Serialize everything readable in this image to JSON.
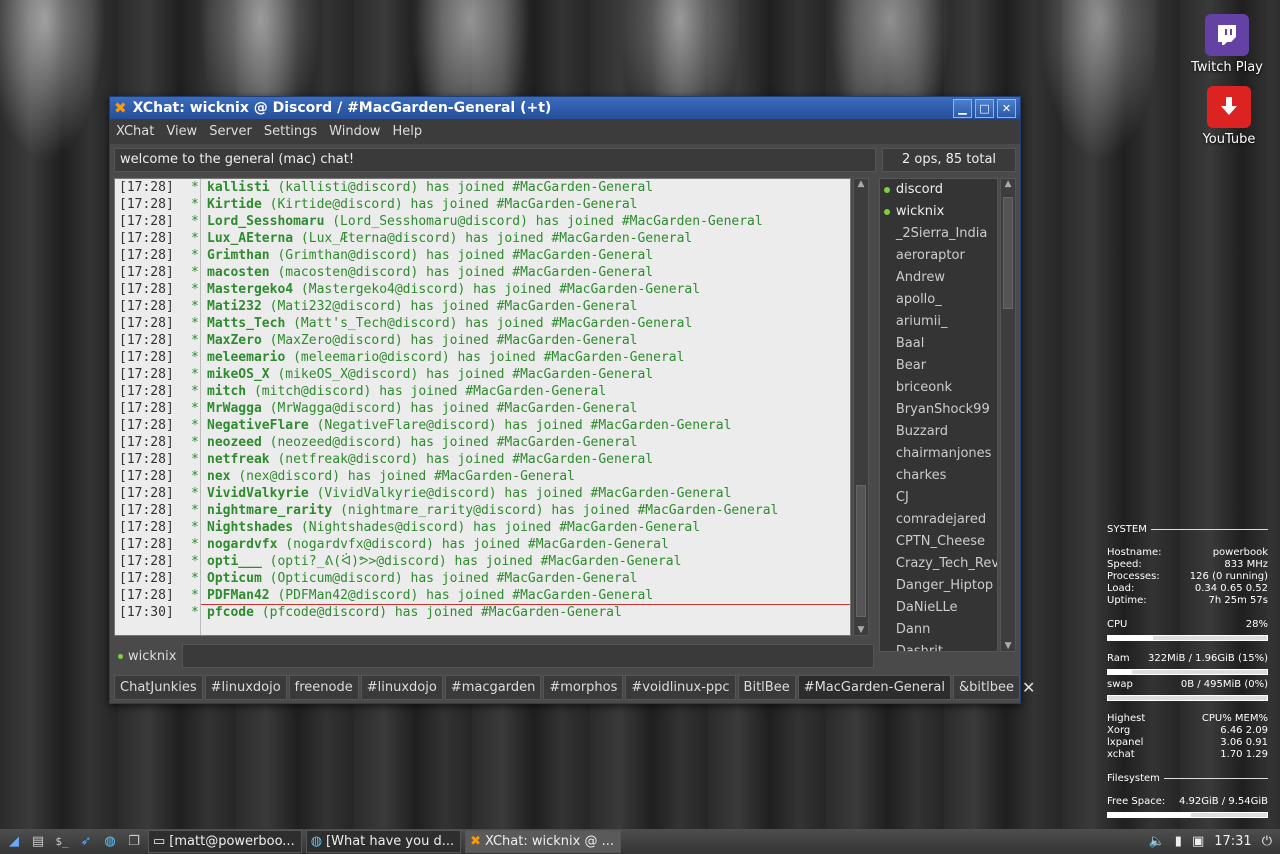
{
  "desktop": {
    "icons": [
      {
        "label": "Twitch Play"
      },
      {
        "label": "YouTube"
      }
    ]
  },
  "window": {
    "title": "XChat: wicknix @ Discord / #MacGarden-General (+t)",
    "menu": [
      "XChat",
      "View",
      "Server",
      "Settings",
      "Window",
      "Help"
    ],
    "topic": "welcome to the general (mac) chat!",
    "user_count": "2 ops, 85 total",
    "nick": "wicknix",
    "messages": [
      {
        "time": "[17:28]",
        "nick": "kallisti",
        "text": "(kallisti@discord) has joined #MacGarden-General"
      },
      {
        "time": "[17:28]",
        "nick": "Kirtide",
        "text": "(Kirtide@discord) has joined #MacGarden-General"
      },
      {
        "time": "[17:28]",
        "nick": "Lord_Sesshomaru",
        "text": "(Lord_Sesshomaru@discord) has joined #MacGarden-General"
      },
      {
        "time": "[17:28]",
        "nick": "Lux_AEterna",
        "text": "(Lux_Æterna@discord) has joined #MacGarden-General"
      },
      {
        "time": "[17:28]",
        "nick": "Grimthan",
        "text": "(Grimthan@discord) has joined #MacGarden-General"
      },
      {
        "time": "[17:28]",
        "nick": "macosten",
        "text": "(macosten@discord) has joined #MacGarden-General"
      },
      {
        "time": "[17:28]",
        "nick": "Mastergeko4",
        "text": "(Mastergeko4@discord) has joined #MacGarden-General"
      },
      {
        "time": "[17:28]",
        "nick": "Mati232",
        "text": "(Mati232@discord) has joined #MacGarden-General"
      },
      {
        "time": "[17:28]",
        "nick": "Matts_Tech",
        "text": "(Matt's_Tech@discord) has joined #MacGarden-General"
      },
      {
        "time": "[17:28]",
        "nick": "MaxZero",
        "text": "(MaxZero@discord) has joined #MacGarden-General"
      },
      {
        "time": "[17:28]",
        "nick": "meleemario",
        "text": "(meleemario@discord) has joined #MacGarden-General"
      },
      {
        "time": "[17:28]",
        "nick": "mikeOS_X",
        "text": "(mikeOS_X@discord) has joined #MacGarden-General"
      },
      {
        "time": "[17:28]",
        "nick": "mitch",
        "text": "(mitch@discord) has joined #MacGarden-General"
      },
      {
        "time": "[17:28]",
        "nick": "MrWagga",
        "text": "(MrWagga@discord) has joined #MacGarden-General"
      },
      {
        "time": "[17:28]",
        "nick": "NegativeFlare",
        "text": "(NegativeFlare@discord) has joined #MacGarden-General"
      },
      {
        "time": "[17:28]",
        "nick": "neozeed",
        "text": "(neozeed@discord) has joined #MacGarden-General"
      },
      {
        "time": "[17:28]",
        "nick": "netfreak",
        "text": "(netfreak@discord) has joined #MacGarden-General"
      },
      {
        "time": "[17:28]",
        "nick": "nex",
        "text": "(nex@discord) has joined #MacGarden-General"
      },
      {
        "time": "[17:28]",
        "nick": "VividValkyrie",
        "text": "(VividValkyrie@discord) has joined #MacGarden-General"
      },
      {
        "time": "[17:28]",
        "nick": "nightmare_rarity",
        "text": "(nightmare_rarity@discord) has joined #MacGarden-General"
      },
      {
        "time": "[17:28]",
        "nick": "Nightshades",
        "text": "(Nightshades@discord) has joined #MacGarden-General"
      },
      {
        "time": "[17:28]",
        "nick": "nogardvfx",
        "text": "(nogardvfx@discord) has joined #MacGarden-General"
      },
      {
        "time": "[17:28]",
        "nick": "opti___",
        "text": "(opti?_ᕕ(ᐛ)ᕗ>@discord) has joined #MacGarden-General"
      },
      {
        "time": "[17:28]",
        "nick": "Opticum",
        "text": "(Opticum@discord) has joined #MacGarden-General"
      },
      {
        "time": "[17:28]",
        "nick": "PDFMan42",
        "text": "(PDFMan42@discord) has joined #MacGarden-General"
      },
      {
        "time": "[17:30]",
        "nick": "pfcode",
        "text": "(pfcode@discord) has joined #MacGarden-General"
      }
    ],
    "star": "*",
    "users": [
      {
        "name": "discord",
        "op": true
      },
      {
        "name": "wicknix",
        "op": true
      },
      {
        "name": "_2Sierra_India",
        "op": false
      },
      {
        "name": "aeroraptor",
        "op": false
      },
      {
        "name": "Andrew",
        "op": false
      },
      {
        "name": "apollo_",
        "op": false
      },
      {
        "name": "ariumii_",
        "op": false
      },
      {
        "name": "Baal",
        "op": false
      },
      {
        "name": "Bear",
        "op": false
      },
      {
        "name": "briceonk",
        "op": false
      },
      {
        "name": "BryanShock99",
        "op": false
      },
      {
        "name": "Buzzard",
        "op": false
      },
      {
        "name": "chairmanjones",
        "op": false
      },
      {
        "name": "charkes",
        "op": false
      },
      {
        "name": "CJ",
        "op": false
      },
      {
        "name": "comradejared",
        "op": false
      },
      {
        "name": "CPTN_Cheese",
        "op": false
      },
      {
        "name": "Crazy_Tech_Revi",
        "op": false
      },
      {
        "name": "Danger_Hiptop",
        "op": false
      },
      {
        "name": "DaNieLLe",
        "op": false
      },
      {
        "name": "Dann",
        "op": false
      },
      {
        "name": "Dashrit",
        "op": false
      }
    ],
    "tabs": [
      {
        "label": "ChatJunkies",
        "active": false
      },
      {
        "label": "#linuxdojo",
        "active": false
      },
      {
        "label": "freenode",
        "active": false,
        "gap_before": true
      },
      {
        "label": "#linuxdojo",
        "active": false
      },
      {
        "label": "#macgarden",
        "active": false
      },
      {
        "label": "#morphos",
        "active": false
      },
      {
        "label": "#voidlinux-ppc",
        "active": false
      },
      {
        "label": "BitlBee",
        "active": false,
        "gap_before": true
      },
      {
        "label": "#MacGarden-General",
        "active": true
      },
      {
        "label": "&bitlbee",
        "active": false
      }
    ],
    "close_tab_label": "✕"
  },
  "conky": {
    "system_label": "SYSTEM",
    "hostname_label": "Hostname:",
    "hostname": "powerbook",
    "speed_label": "Speed:",
    "speed": "833 MHz",
    "processes_label": "Processes:",
    "processes": "126 (0 running)",
    "load_label": "Load:",
    "load": "0.34 0.65 0.52",
    "uptime_label": "Uptime:",
    "uptime": "7h 25m 57s",
    "cpu_label": "CPU",
    "cpu": "28%",
    "cpu_fraction": 0.28,
    "ram_label": "Ram",
    "ram": "322MiB / 1.96GiB (15%)",
    "ram_fraction": 0.15,
    "swap_label": "swap",
    "swap": "0B / 495MiB (0%)",
    "swap_fraction": 0.0,
    "highest_label": "Highest",
    "highest_cols": "CPU% MEM%",
    "procs": [
      {
        "name": "Xorg",
        "vals": "6.46  2.09"
      },
      {
        "name": "lxpanel",
        "vals": "3.06  0.91"
      },
      {
        "name": "xchat",
        "vals": "1.70  1.29"
      }
    ],
    "filesystem_label": "Filesystem",
    "free_space_label": "Free Space:",
    "free_space": "4.92GiB / 9.54GiB",
    "free_fraction": 0.52
  },
  "taskbar": {
    "tasks": [
      {
        "label": "[matt@powerboo...",
        "active": false
      },
      {
        "label": "[What have you d...",
        "active": false
      },
      {
        "label": "XChat: wicknix @ ...",
        "active": true
      }
    ],
    "clock": "17:31"
  }
}
